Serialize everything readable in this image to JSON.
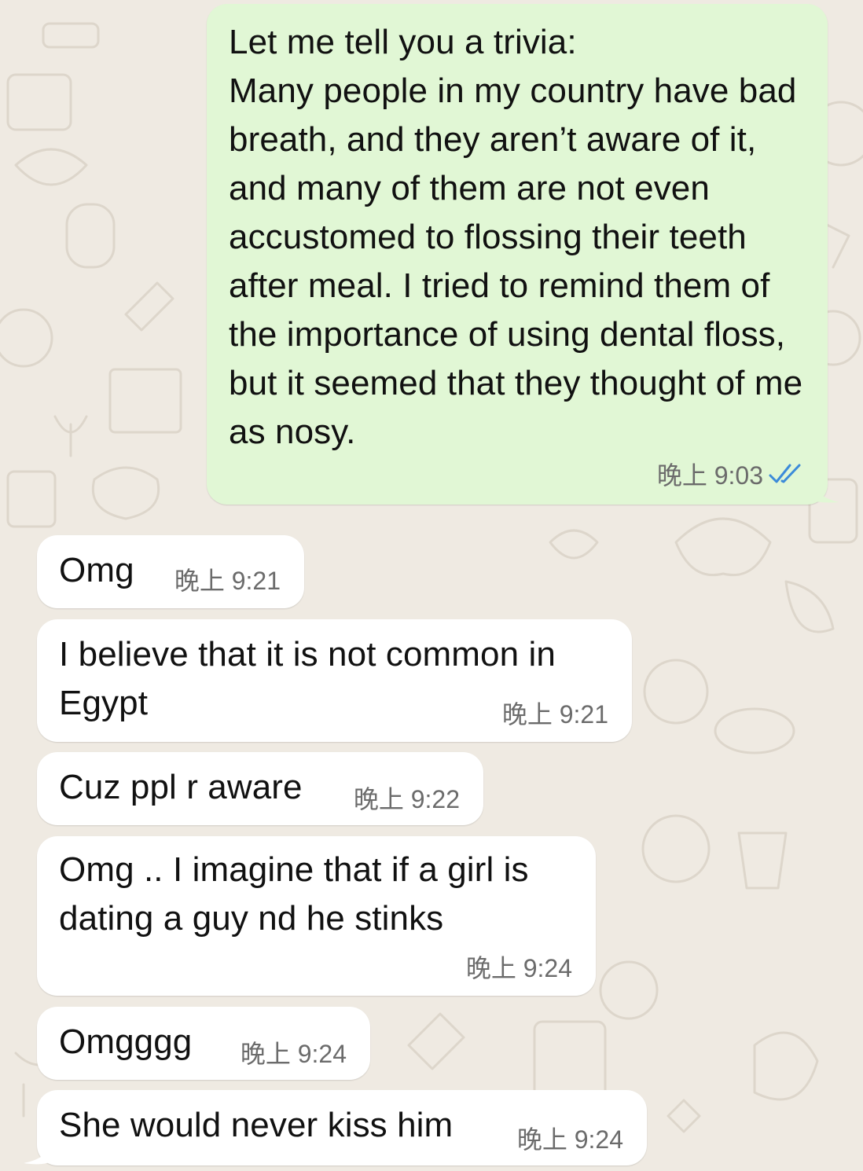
{
  "colors": {
    "background": "#efeae2",
    "incoming_bubble": "#ffffff",
    "outgoing_bubble": "#e1f7d5",
    "timestamp": "#6b6b6b",
    "read_ticks": "#3c8bd9"
  },
  "messages": [
    {
      "direction": "outgoing",
      "text": "Let me tell you a trivia:\nMany people in my country have bad breath, and they aren’t aware of it, and many of them are not even accustomed to flossing their teeth after meal. I tried to remind them of the importance of using dental floss, but it seemed that they thought of me as nosy.",
      "time": "晚上 9:03",
      "status_icon": "double-check-read-icon"
    },
    {
      "direction": "incoming",
      "text": "Omg",
      "time": "晚上 9:21"
    },
    {
      "direction": "incoming",
      "text": "I believe that it is not common in Egypt",
      "time": "晚上 9:21"
    },
    {
      "direction": "incoming",
      "text": "Cuz ppl r aware",
      "time": "晚上 9:22"
    },
    {
      "direction": "incoming",
      "text": "Omg .. I imagine that if a girl is dating a guy nd he stinks",
      "time": "晚上 9:24"
    },
    {
      "direction": "incoming",
      "text": "Omgggg",
      "time": "晚上 9:24"
    },
    {
      "direction": "incoming",
      "text": "She would never kiss him",
      "time": "晚上 9:24"
    }
  ]
}
